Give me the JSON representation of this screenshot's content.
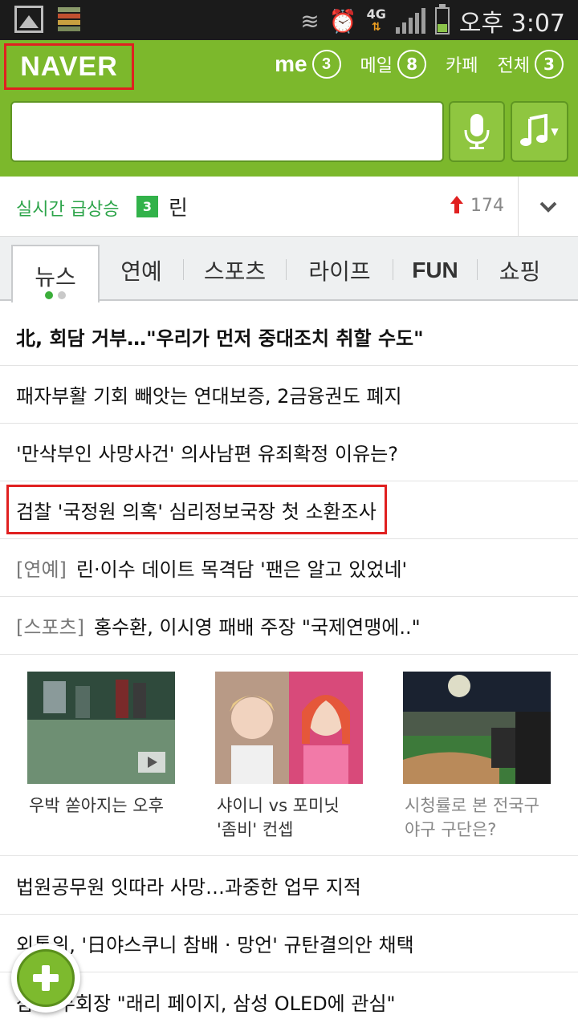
{
  "status_bar": {
    "time": "오후 3:07",
    "network": "4G",
    "icons": [
      "gallery-icon",
      "flag-icon",
      "vibrate-icon",
      "alarm-icon",
      "signal-icon",
      "battery-icon"
    ]
  },
  "header": {
    "logo": "NAVER",
    "quick_links": [
      {
        "label": "me",
        "count": "3"
      },
      {
        "label": "메일",
        "count": "8"
      },
      {
        "label": "카페",
        "count": ""
      },
      {
        "label": "전체",
        "count": "3"
      }
    ],
    "search_value": "",
    "colors": {
      "brand": "#7cb82c",
      "highlight": "#e02020"
    }
  },
  "realtime": {
    "label": "실시간 급상승",
    "rank": "3",
    "keyword": "린",
    "count": "174"
  },
  "tabs": [
    {
      "label": "뉴스",
      "active": true
    },
    {
      "label": "연예"
    },
    {
      "label": "스포츠"
    },
    {
      "label": "라이프"
    },
    {
      "label": "FUN"
    },
    {
      "label": "쇼핑"
    }
  ],
  "news": [
    {
      "title": "北, 회담 거부…\"우리가 먼저 중대조치 취할 수도\""
    },
    {
      "title": "패자부활 기회 빼앗는 연대보증, 2금융권도 폐지"
    },
    {
      "title": "'만삭부인 사망사건' 의사남편 유죄확정 이유는?"
    },
    {
      "title": "검찰 '국정원 의혹' 심리정보국장 첫 소환조사"
    },
    {
      "category": "[연예]",
      "title": "린·이수 데이트 목격담 '팬은 알고 있었네'"
    },
    {
      "category": "[스포츠]",
      "title": "홍수환, 이시영 패배 주장 \"국제연맹에..\""
    }
  ],
  "photo_cards": [
    {
      "caption": "우박 쏟아지는 오후"
    },
    {
      "caption": "샤이니 vs 포미닛 '좀비' 컨셉"
    },
    {
      "caption": "시청률로 본 전국구 야구 구단은?"
    }
  ],
  "news_more": [
    {
      "title": "법원공무원 잇따라 사망…과중한 업무 지적"
    },
    {
      "title": "외통위, '日야스쿠니 참배 · 망언' 규탄결의안 채택"
    },
    {
      "title": "삼성 부회장 \"래리 페이지, 삼성 OLED에 관심\""
    }
  ]
}
